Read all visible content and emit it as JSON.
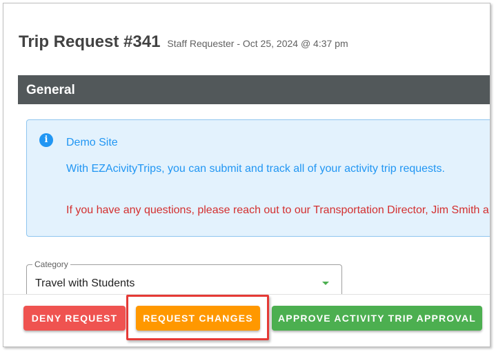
{
  "header": {
    "title": "Trip Request #341",
    "subtitle": "Staff Requester - Oct 25, 2024 @ 4:37 pm"
  },
  "section": {
    "title": "General"
  },
  "alert": {
    "icon": "info-icon",
    "title": "Demo Site",
    "line1": "With EZAcivityTrips, you can submit and track all of your activity trip requests.",
    "line2": "If you have any questions, please reach out to our Transportation Director, Jim Smith a",
    "colors": {
      "info": "#2196f3",
      "warning": "#d32f2f",
      "background": "#e3f2fd"
    }
  },
  "category": {
    "label": "Category",
    "value": "Travel with Students"
  },
  "actions": {
    "deny_label": "DENY REQUEST",
    "changes_label": "REQUEST CHANGES",
    "approve_label": "APPROVE ACTIVITY TRIP APPROVAL",
    "colors": {
      "deny": "#ef5350",
      "changes": "#ff9800",
      "approve": "#4caf50",
      "highlight": "#e53935"
    }
  }
}
